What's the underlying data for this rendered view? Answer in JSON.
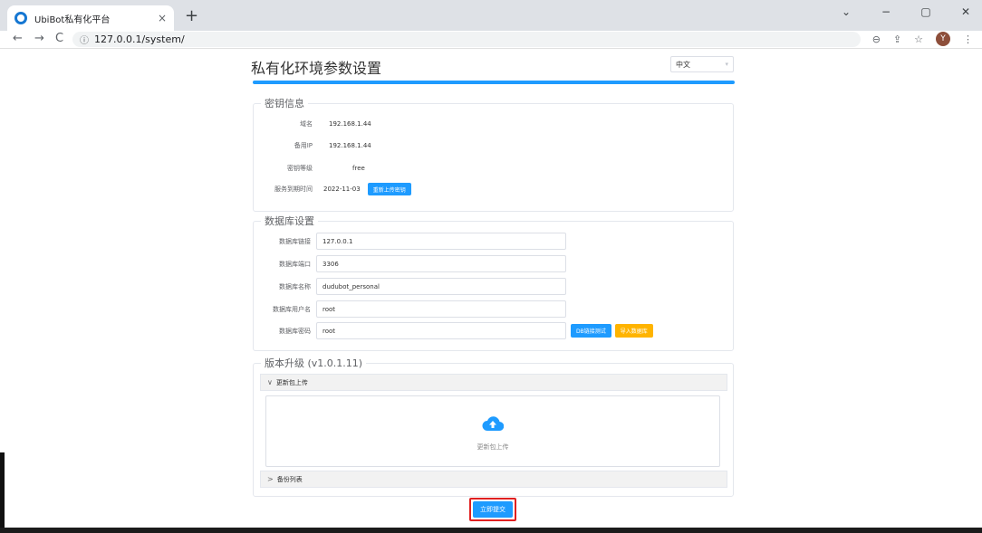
{
  "browser": {
    "tab_title": "UbiBot私有化平台",
    "tab_close": "×",
    "new_tab": "+",
    "url": "127.0.0.1/system/",
    "profile_initial": "Y",
    "back": "←",
    "forward": "→",
    "reload": "C",
    "info_icon": "ⓘ",
    "zoom": "⊖",
    "share": "⇪",
    "star": "☆",
    "menu": "⋮",
    "win_chevron": "⌄",
    "win_min": "−",
    "win_max": "▢",
    "win_close": "✕"
  },
  "page": {
    "title": "私有化环境参数设置",
    "language": "中文",
    "language_caret": "▾"
  },
  "key_info": {
    "legend": "密钥信息",
    "rows": [
      {
        "label": "域名",
        "value": "192.168.1.44"
      },
      {
        "label": "备用IP",
        "value": "192.168.1.44"
      },
      {
        "label": "密钥等级",
        "value": "free"
      },
      {
        "label": "服务到期时间",
        "value": "2022-11-03"
      }
    ],
    "reupload_button": "重新上传密钥"
  },
  "database": {
    "legend": "数据库设置",
    "fields": [
      {
        "label": "数据库链接",
        "value": "127.0.0.1"
      },
      {
        "label": "数据库端口",
        "value": "3306"
      },
      {
        "label": "数据库名称",
        "value": "dudubot_personal"
      },
      {
        "label": "数据库用户名",
        "value": "root"
      },
      {
        "label": "数据库密码",
        "value": "root"
      }
    ],
    "test_button": "DB链接测试",
    "import_button": "导入数据库"
  },
  "upgrade": {
    "legend": "版本升级 (v1.0.1.11)",
    "upload_section": "更新包上传",
    "upload_text": "更新包上传",
    "backup_section": "备份列表",
    "chevron_open": "∨",
    "chevron_closed": ">"
  },
  "submit_label": "立即提交",
  "colors": {
    "accent": "#1e9bff",
    "warning": "#ffb400",
    "highlight_border": "#e02020"
  }
}
